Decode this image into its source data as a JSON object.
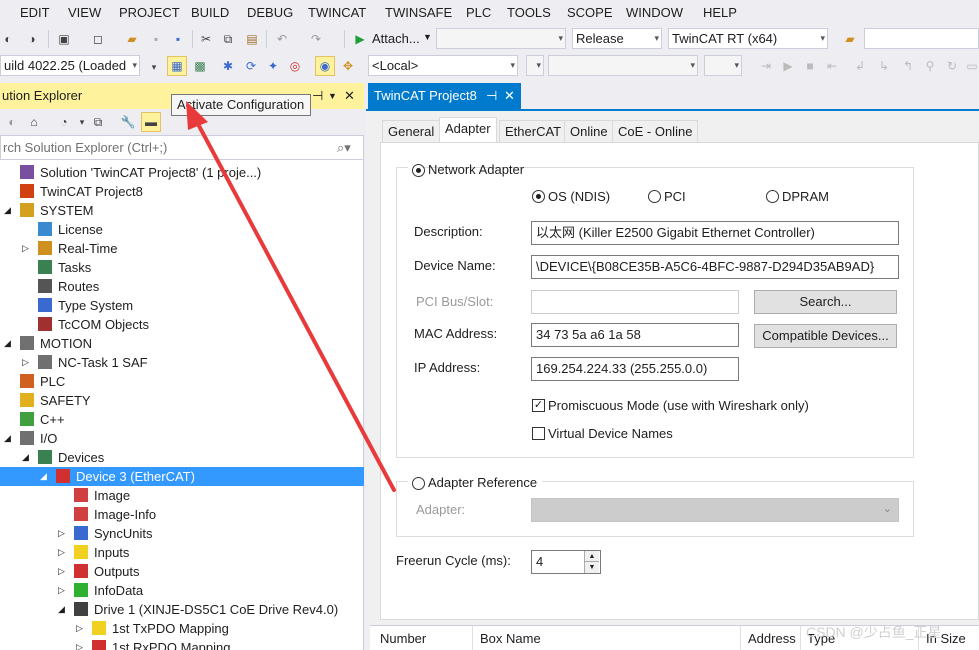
{
  "menu": [
    "EDIT",
    "VIEW",
    "PROJECT",
    "BUILD",
    "DEBUG",
    "TWINCAT",
    "TWINSAFE",
    "PLC",
    "TOOLS",
    "SCOPE",
    "WINDOW",
    "HELP"
  ],
  "toolbar": {
    "attach_label": "Attach...",
    "config_value": "Release",
    "platform_value": "TwinCAT RT (x64)",
    "build_value": "uild 4022.25 (Loaded",
    "target_value": "<Local>"
  },
  "solution_explorer": {
    "title": "ution Explorer",
    "search_placeholder": "rch Solution Explorer (Ctrl+;)",
    "tree": [
      {
        "label": "Solution 'TwinCAT Project8' (1 proje...)",
        "indent": 0,
        "expander": "",
        "icon": "solution-icon",
        "color": "#7a4fa0"
      },
      {
        "label": "TwinCAT Project8",
        "indent": 1,
        "expander": "",
        "icon": "twincat-project-icon",
        "color": "#d04010"
      },
      {
        "label": "SYSTEM",
        "indent": 1,
        "expander": "◢",
        "icon": "system-icon",
        "color": "#d4a020"
      },
      {
        "label": "License",
        "indent": 2,
        "expander": "",
        "icon": "license-icon",
        "color": "#3a8ad0"
      },
      {
        "label": "Real-Time",
        "indent": 2,
        "expander": "▷",
        "icon": "realtime-icon",
        "color": "#d09020"
      },
      {
        "label": "Tasks",
        "indent": 2,
        "expander": "",
        "icon": "tasks-icon",
        "color": "#3a8050"
      },
      {
        "label": "Routes",
        "indent": 2,
        "expander": "",
        "icon": "routes-icon",
        "color": "#555555"
      },
      {
        "label": "Type System",
        "indent": 2,
        "expander": "",
        "icon": "type-system-icon",
        "color": "#3a6ad0"
      },
      {
        "label": "TcCOM Objects",
        "indent": 2,
        "expander": "",
        "icon": "tccom-icon",
        "color": "#a03030"
      },
      {
        "label": "MOTION",
        "indent": 1,
        "expander": "◢",
        "icon": "motion-icon",
        "color": "#707070"
      },
      {
        "label": "NC-Task 1 SAF",
        "indent": 2,
        "expander": "▷",
        "icon": "nc-task-icon",
        "color": "#707070"
      },
      {
        "label": "PLC",
        "indent": 1,
        "expander": "",
        "icon": "plc-icon",
        "color": "#d06020"
      },
      {
        "label": "SAFETY",
        "indent": 1,
        "expander": "",
        "icon": "safety-icon",
        "color": "#e0b020"
      },
      {
        "label": "C++",
        "indent": 1,
        "expander": "",
        "icon": "cpp-icon",
        "color": "#40a040"
      },
      {
        "label": "I/O",
        "indent": 1,
        "expander": "◢",
        "icon": "io-icon",
        "color": "#707070"
      },
      {
        "label": "Devices",
        "indent": 2,
        "expander": "◢",
        "icon": "devices-icon",
        "color": "#3a8050"
      },
      {
        "label": "Device 3 (EtherCAT)",
        "indent": 3,
        "expander": "◢",
        "icon": "ethercat-device-icon",
        "color": "#d03030",
        "selected": true
      },
      {
        "label": "Image",
        "indent": 4,
        "expander": "",
        "icon": "image-icon",
        "color": "#d04040"
      },
      {
        "label": "Image-Info",
        "indent": 4,
        "expander": "",
        "icon": "image-info-icon",
        "color": "#d04040"
      },
      {
        "label": "SyncUnits",
        "indent": 4,
        "expander": "▷",
        "icon": "syncunits-icon",
        "color": "#3a6ad0"
      },
      {
        "label": "Inputs",
        "indent": 4,
        "expander": "▷",
        "icon": "inputs-icon",
        "color": "#f0d020"
      },
      {
        "label": "Outputs",
        "indent": 4,
        "expander": "▷",
        "icon": "outputs-icon",
        "color": "#d03030"
      },
      {
        "label": "InfoData",
        "indent": 4,
        "expander": "▷",
        "icon": "infodata-icon",
        "color": "#30b030"
      },
      {
        "label": "Drive 1 (XINJE-DS5C1 CoE Drive Rev4.0)",
        "indent": 4,
        "expander": "◢",
        "icon": "drive-icon",
        "color": "#404040"
      },
      {
        "label": "1st TxPDO Mapping",
        "indent": 5,
        "expander": "▷",
        "icon": "txpdo-icon",
        "color": "#f0d020"
      },
      {
        "label": "1st RxPDO Mapping",
        "indent": 5,
        "expander": "▷",
        "icon": "rxpdo-icon",
        "color": "#d03030"
      }
    ]
  },
  "tooltip": "Activate Configuration",
  "document_tab": "TwinCAT Project8",
  "sub_tabs": [
    "General",
    "Adapter",
    "EtherCAT",
    "Online",
    "CoE - Online"
  ],
  "active_sub_tab": "Adapter",
  "adapter": {
    "network_adapter_label": "Network Adapter",
    "os_ndis": "OS (NDIS)",
    "pci": "PCI",
    "dpram": "DPRAM",
    "description_label": "Description:",
    "description_value": "以太网 (Killer E2500 Gigabit Ethernet Controller)",
    "device_name_label": "Device Name:",
    "device_name_value": "\\DEVICE\\{B08CE35B-A5C6-4BFC-9887-D294D35AB9AD}",
    "pci_bus_label": "PCI Bus/Slot:",
    "pci_bus_value": "",
    "search_button": "Search...",
    "mac_label": "MAC Address:",
    "mac_value": "34 73 5a a6 1a 58",
    "compatible_button": "Compatible Devices...",
    "ip_label": "IP Address:",
    "ip_value": "169.254.224.33 (255.255.0.0)",
    "promiscuous_label": "Promiscuous Mode (use with Wireshark only)",
    "promiscuous_checked": true,
    "virtual_names_label": "Virtual Device Names",
    "virtual_names_checked": false,
    "adapter_reference_label": "Adapter Reference",
    "adapter_field_label": "Adapter:",
    "freerun_label": "Freerun Cycle (ms):",
    "freerun_value": "4"
  },
  "list_columns": [
    "Number",
    "Box Name",
    "Address",
    "Type",
    "In Size"
  ],
  "watermark": "CSDN @少占鱼_正星",
  "colors": {
    "accent": "#007acc",
    "selection": "#3399ff",
    "explorer_title": "#fff29d",
    "arrow": "#e83a3a"
  }
}
